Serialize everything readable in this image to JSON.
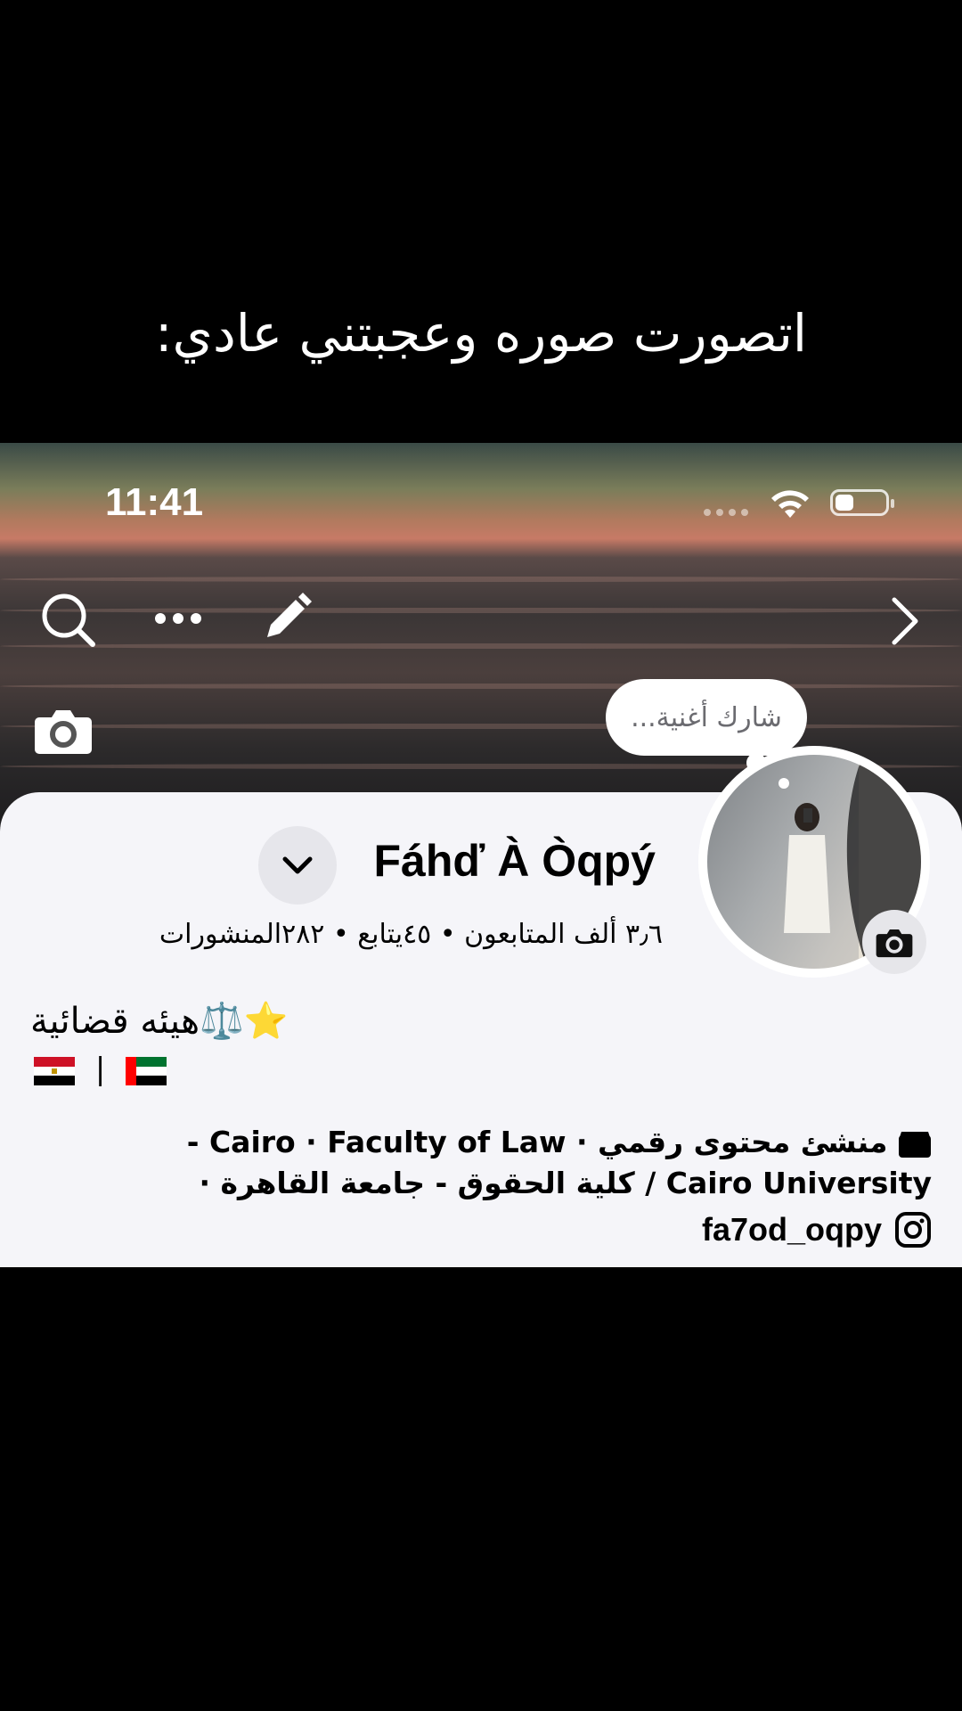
{
  "caption": "اتصورت صوره وعجبتني عادي:",
  "status": {
    "time": "11:41"
  },
  "bubble": {
    "text": "شارك أغنية..."
  },
  "profile": {
    "name": "Fáhď À Òqpý",
    "stats": "٣٫٦ ألف المتابعون • ٤٥يتابع • ٢٨٢المنشورات",
    "bio_line1": "هيئه قضائية⚖️⭐️",
    "bio_flags_separator": "|",
    "detail_line1": "منشئ محتوى رقمي · Cairo · Faculty of Law -",
    "detail_line2": "Cairo University / كلية الحقوق - جامعة القاهرة ·",
    "instagram": "fa7od_oqpy"
  },
  "icons": [
    "search-icon",
    "more-icon",
    "edit-icon",
    "chevron-right-icon",
    "camera-icon",
    "chevron-down-icon",
    "clapper-icon",
    "location-pin-icon",
    "graduation-cap-icon",
    "instagram-icon",
    "wifi-icon",
    "battery-icon"
  ],
  "colors": {
    "sheet_bg": "#f5f5f9",
    "chip_bg": "#e6e6eb"
  }
}
